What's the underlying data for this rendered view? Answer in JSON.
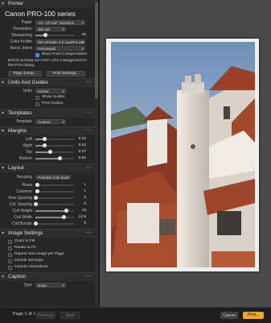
{
  "printer": {
    "section": "Printer",
    "name": "Canon PRO-100 series",
    "paper_label": "Paper",
    "paper": "A3+ 13\"x19\" 33x48cm",
    "resolution_label": "Resolution",
    "resolution": "300 ppi",
    "sharpening_label": "Sharpening",
    "sharpening": "25",
    "color_profile_label": "Color Profile",
    "color_profile": "RR UPSatin 4.0 CanPro-100",
    "rend_intent_label": "Rend. Intent",
    "rend_intent": "Perceptual",
    "bpc_label": "Black Point Compensation",
    "note": "Before printing turn OFF color management in the Print dialog.",
    "page_setup": "Page Setup...",
    "print_settings": "Print Settings..."
  },
  "units": {
    "section": "Units And Guides",
    "units_label": "Units",
    "units": "Inches",
    "show_guides": "Show Guides",
    "print_guides": "Print Guides"
  },
  "templates": {
    "section": "Templates",
    "template_label": "Template",
    "template": "Custom"
  },
  "margins": {
    "section": "Margins",
    "rows": [
      {
        "label": "Left",
        "value": "0.22",
        "level": 0.22
      },
      {
        "label": "Right",
        "value": "0.22",
        "level": 0.22
      },
      {
        "label": "Top",
        "value": "0.37",
        "level": 0.37
      },
      {
        "label": "Bottom",
        "value": "0.63",
        "level": 0.63
      }
    ]
  },
  "layout": {
    "section": "Layout",
    "resizing_label": "Resizing",
    "resizing": "Prioritize Cell Size",
    "rows": [
      {
        "label": "Rows",
        "value": "1",
        "level": 0.05
      },
      {
        "label": "Columns",
        "value": "1",
        "level": 0.05
      },
      {
        "label": "Row Spacing",
        "value": "0",
        "level": 0
      },
      {
        "label": "Col. Spacing",
        "value": "0",
        "level": 0
      },
      {
        "label": "Cell Height",
        "value": "18",
        "level": 0.8
      },
      {
        "label": "Cell Width",
        "value": "12.5",
        "level": 0.72
      },
      {
        "label": "Cell Border",
        "value": "0",
        "level": 0
      }
    ]
  },
  "image_settings": {
    "section": "Image Settings",
    "options": [
      "Zoom to Fill",
      "Rotate to Fit",
      "Repeat One Image per Page",
      "Include Overlays",
      "Include Annotations"
    ]
  },
  "caption": {
    "section": "Caption",
    "type_label": "Type",
    "type": "None"
  },
  "footer": {
    "page_info": "Page 1 of 1",
    "previous": "Previous",
    "next": "Next",
    "cancel": "Cancel",
    "print": "Print..."
  },
  "colors": {
    "accent": "#4d8fe6",
    "print_button": "#f5a623"
  }
}
